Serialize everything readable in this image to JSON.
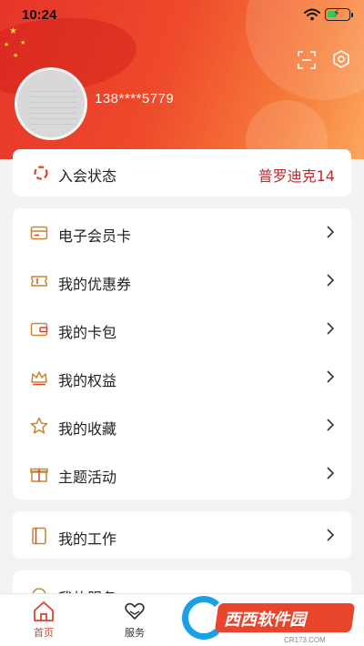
{
  "status_bar": {
    "time": "10:24"
  },
  "profile": {
    "phone": "138****5779"
  },
  "membership": {
    "label": "入会状态",
    "value": "普罗迪克14"
  },
  "menu_primary": [
    {
      "label": "电子会员卡",
      "icon": "member-card-icon"
    },
    {
      "label": "我的优惠券",
      "icon": "coupon-icon"
    },
    {
      "label": "我的卡包",
      "icon": "wallet-icon"
    },
    {
      "label": "我的权益",
      "icon": "crown-icon"
    },
    {
      "label": "我的收藏",
      "icon": "star-icon"
    },
    {
      "label": "主题活动",
      "icon": "gift-icon"
    }
  ],
  "menu_work": {
    "label": "我的工作",
    "icon": "notebook-icon"
  },
  "menu_service_partial": {
    "label": "我的服务"
  },
  "tabbar": {
    "home": "首页",
    "service": "服务"
  },
  "watermark": {
    "text": "西西软件园",
    "sub": "CR173.COM"
  },
  "colors": {
    "accent": "#e0412d",
    "membership_value": "#c0282c",
    "header_start": "#e6352a",
    "header_end": "#fba760"
  }
}
